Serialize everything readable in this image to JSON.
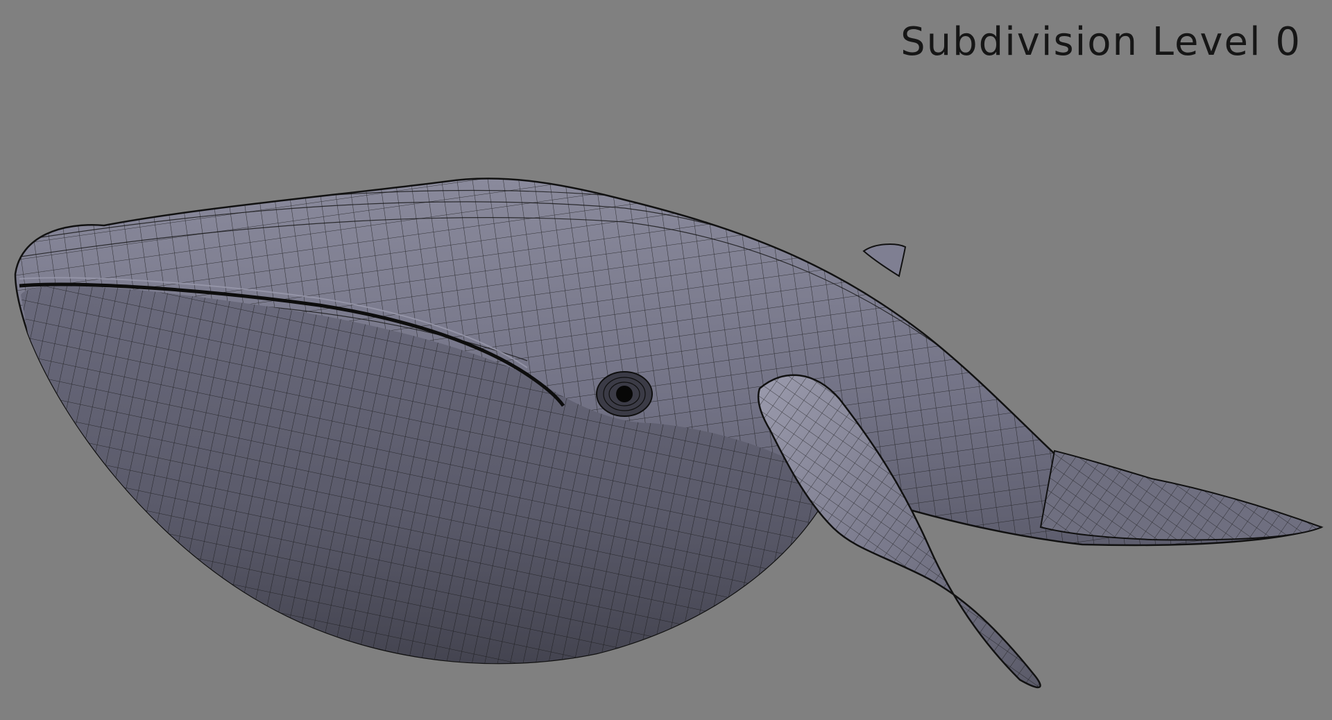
{
  "viewport": {
    "overlay_label": "Subdivision Level 0",
    "background_color": "#808080"
  },
  "model": {
    "subject": "whale-mesh",
    "display_mode": "wireframe-on-shaded",
    "surface_color": "#6e6e80",
    "wire_color": "#141414"
  }
}
